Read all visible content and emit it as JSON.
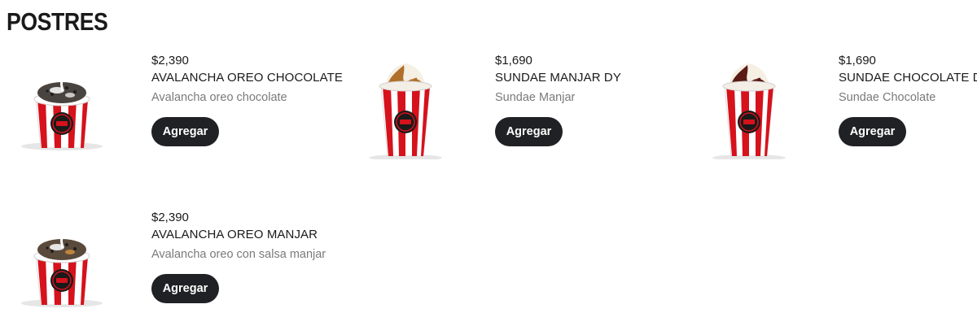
{
  "section": {
    "title": "POSTRES"
  },
  "products": [
    {
      "price": "$2,390",
      "name": "AVALANCHA OREO CHOCOLATE",
      "description": "Avalancha oreo chocolate",
      "button_label": "Agregar",
      "image_icon": "avalancha-cup-icon"
    },
    {
      "price": "$1,690",
      "name": "SUNDAE MANJAR DY",
      "description": "Sundae Manjar",
      "button_label": "Agregar",
      "image_icon": "sundae-cup-icon"
    },
    {
      "price": "$1,690",
      "name": "SUNDAE CHOCOLATE DY",
      "description": "Sundae Chocolate",
      "button_label": "Agregar",
      "image_icon": "sundae-cup-icon"
    },
    {
      "price": "$2,390",
      "name": "AVALANCHA OREO MANJAR",
      "description": "Avalancha oreo con salsa manjar",
      "button_label": "Agregar",
      "image_icon": "avalancha-cup-icon"
    }
  ],
  "colors": {
    "cup_red": "#d6121c",
    "cup_white": "#ffffff",
    "button_bg": "#202124",
    "description_text": "#7a7a7a",
    "manjar_sauce": "#b0702a",
    "chocolate_sauce": "#5a1c14",
    "oreo_crumbs": "#3a3a3a"
  }
}
